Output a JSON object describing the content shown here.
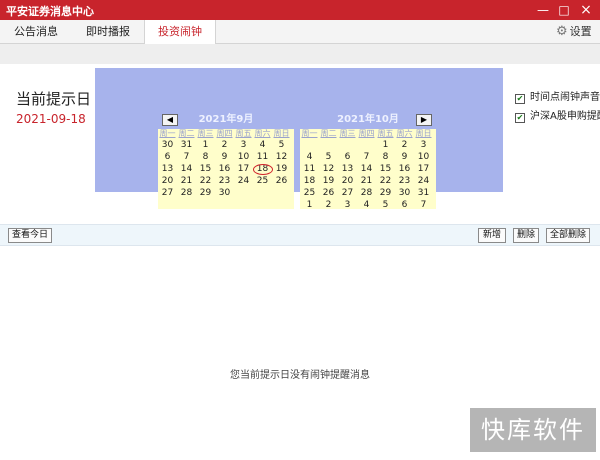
{
  "window": {
    "title": "平安证券消息中心",
    "minimize": "—",
    "maximize": "□",
    "close": "×"
  },
  "tabs": [
    {
      "label": "公告消息"
    },
    {
      "label": "即时播报"
    },
    {
      "label": "投资闹钟"
    }
  ],
  "settings": {
    "icon": "gear-icon",
    "label": "设置"
  },
  "reminder": {
    "title": "当前提示日",
    "date": "2021-09-18"
  },
  "calendar": {
    "weekdays": [
      "周一",
      "周二",
      "周三",
      "周四",
      "周五",
      "周六",
      "周日"
    ],
    "months": [
      {
        "title": "2021年9月",
        "nav": "◀",
        "weeks": [
          [
            "30",
            "31",
            "1",
            "2",
            "3",
            "4",
            "5"
          ],
          [
            "6",
            "7",
            "8",
            "9",
            "10",
            "11",
            "12"
          ],
          [
            "13",
            "14",
            "15",
            "16",
            "17",
            "18",
            "19"
          ],
          [
            "20",
            "21",
            "22",
            "23",
            "24",
            "25",
            "26"
          ],
          [
            "27",
            "28",
            "29",
            "30",
            "",
            "",
            ""
          ]
        ],
        "today": "18"
      },
      {
        "title": "2021年10月",
        "nav": "▶",
        "weeks": [
          [
            "",
            "",
            "",
            "",
            "1",
            "2",
            "3"
          ],
          [
            "4",
            "5",
            "6",
            "7",
            "8",
            "9",
            "10"
          ],
          [
            "11",
            "12",
            "13",
            "14",
            "15",
            "16",
            "17"
          ],
          [
            "18",
            "19",
            "20",
            "21",
            "22",
            "23",
            "24"
          ],
          [
            "25",
            "26",
            "27",
            "28",
            "29",
            "30",
            "31"
          ],
          [
            "1",
            "2",
            "3",
            "4",
            "5",
            "6",
            "7"
          ]
        ]
      }
    ]
  },
  "options": [
    {
      "label": "时间点闹钟声音",
      "checked": true
    },
    {
      "label": "沪深A股申购提醒",
      "checked": true
    }
  ],
  "toolbar": {
    "view_today": "查看今日",
    "add": "新增",
    "delete": "删除",
    "delete_all": "全部删除"
  },
  "empty_message": "您当前提示日没有闹钟提醒消息",
  "watermark": "快库软件",
  "colors": {
    "titlebar": "#c8242c",
    "calendar_frame": "#a7b3ec",
    "calendar_body": "#fffecb",
    "accent_red": "#c8242c"
  }
}
